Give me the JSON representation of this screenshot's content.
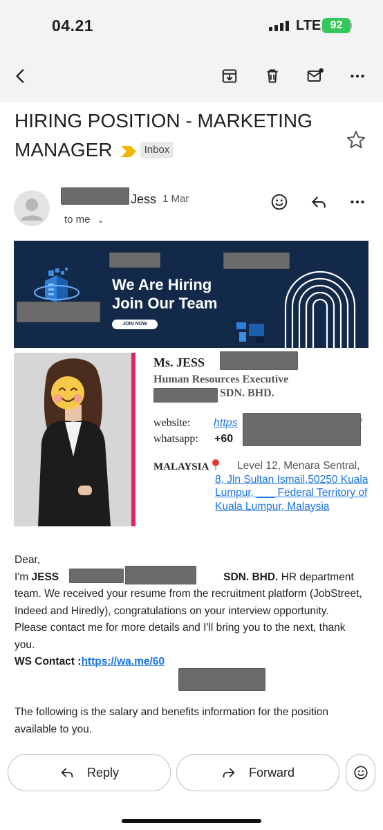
{
  "status_bar": {
    "time": "04.21",
    "network": "LTE",
    "battery": "92"
  },
  "toolbar": {
    "back_icon": "arrow-left-icon",
    "archive_icon": "archive-icon",
    "delete_icon": "trash-icon",
    "unread_icon": "mail-unread-icon",
    "more_icon": "more-horizontal-icon"
  },
  "email": {
    "subject": "HIRING POSITION - MARKETING MANAGER",
    "label": "Inbox",
    "sender_name": "Jess",
    "date": "1 Mar",
    "to": "to me"
  },
  "banner": {
    "line1": "We Are Hiring",
    "line2": "Join Our Team",
    "button": "JOIN NOW"
  },
  "signature": {
    "name": "Ms. JESS",
    "title": "Human Resources Executive",
    "company_suffix": "SDN. BHD.",
    "website_label": "website:",
    "website_value": "https",
    "website_tail": "/",
    "whatsapp_label": "whatsapp:",
    "whatsapp_value": "+60",
    "country": "MALAYSIA",
    "address_plain": "Level 12, Menara Sentral, ",
    "address_link": "8, Jln Sultan Ismail,50250 Kuala Lumpur, ___ Federal Territory of Kuala Lumpur, Malaysia"
  },
  "body": {
    "greeting": "Dear,",
    "im": "I'm ",
    "jess": "JESS",
    "sdn": "SDN. BHD.",
    "intro": " HR department team. We received your resume from the recruitment platform (JobStreet, Indeed and Hiredly), congratulations on your interview opportunity.",
    "contact_request": "Please contact me for more details and I'll bring you to the next, thank you.",
    "ws_label": "WS Contact :",
    "ws_link": "https://wa.me/60",
    "salary_note": "The following is the salary and benefits information for the position available to you."
  },
  "actions": {
    "reply": "Reply",
    "forward": "Forward"
  },
  "colors": {
    "accent": "#1a73e8",
    "important": "#f4b400",
    "banner_bg": "#12294a",
    "photo_bar": "#e0245e",
    "battery": "#34c759"
  }
}
